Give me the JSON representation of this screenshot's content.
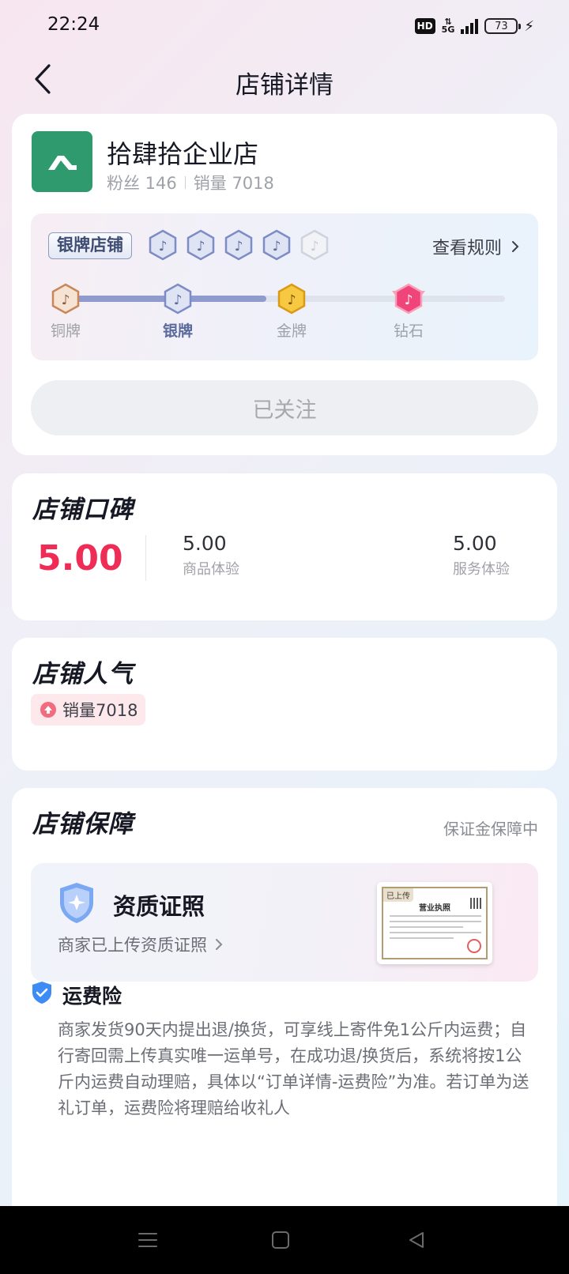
{
  "status_bar": {
    "time": "22:24",
    "hd": "HD",
    "network": "5G",
    "battery": "73"
  },
  "nav": {
    "title": "店铺详情"
  },
  "store": {
    "name": "拾肆拾企业店",
    "fans": "粉丝 146",
    "sales": "销量 7018",
    "level_tag": "银牌店铺",
    "rules_label": "查看规则",
    "tiers": [
      {
        "label": "铜牌",
        "color": "#c8875a"
      },
      {
        "label": "银牌",
        "color": "#7d8cc4"
      },
      {
        "label": "金牌",
        "color": "#e8a41a"
      },
      {
        "label": "钻石",
        "color": "#f0457a"
      }
    ],
    "follow_label": "已关注"
  },
  "rating": {
    "title": "店铺口碑",
    "overall": "5.00",
    "goods_score": "5.00",
    "goods_label": "商品体验",
    "service_score": "5.00",
    "service_label": "服务体验"
  },
  "popularity": {
    "title": "店铺人气",
    "chip": "销量7018"
  },
  "guarantee": {
    "title": "店铺保障",
    "status": "保证金保障中",
    "cert_title": "资质证照",
    "cert_sub": "商家已上传资质证照",
    "license_tag": "已上传",
    "license_head": "营业执照",
    "insurance_title": "运费险",
    "insurance_text": "商家发货90天内提出退/换货，可享线上寄件免1公斤内运费；自行寄回需上传真实唯一运单号，在成功退/换货后，系统将按1公斤内运费自动理赔，具体以“订单详情-运费险”为准。若订单为送礼订单，运费险将理赔给收礼人"
  },
  "colors": {
    "accent_red": "#ee2c55",
    "brand_green": "#2f9a6e",
    "shield_blue": "#3d8bf5"
  }
}
